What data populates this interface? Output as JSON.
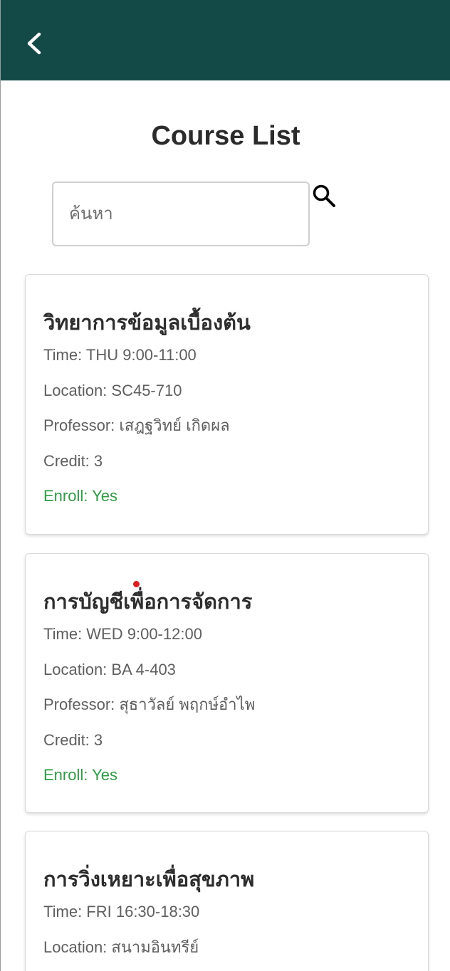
{
  "header": {
    "back_icon": "chevron-left-icon"
  },
  "page": {
    "title": "Course List"
  },
  "search": {
    "placeholder": "ค้นหา",
    "icon": "search-icon"
  },
  "labels": {
    "time": "Time: ",
    "location": "Location: ",
    "professor": "Professor: ",
    "credit": "Credit: ",
    "enroll": "Enroll: "
  },
  "courses": [
    {
      "name": "วิทยาการข้อมูลเบื้องต้น",
      "time": "Time: THU 9:00-11:00",
      "location": "Location: SC45-710",
      "professor": "Professor: เสฎฐวิทย์ เกิดผล",
      "credit": "Credit: 3",
      "enroll": "Enroll: Yes"
    },
    {
      "name": "การบัญชีเพื่อการจัดการ",
      "time": "Time: WED 9:00-12:00",
      "location": "Location: BA 4-403",
      "professor": "Professor: สุธาวัลย์ พฤกษ์อำไพ",
      "credit": "Credit: 3",
      "enroll": "Enroll: Yes"
    },
    {
      "name": "การวิ่งเหยาะเพื่อสุขภาพ",
      "time": "Time: FRI 16:30-18:30",
      "location": "Location: สนามอินทรีย์"
    }
  ],
  "colors": {
    "header_bg": "#134946",
    "enroll_text": "#2e9e43",
    "title_text": "#2b2b2b",
    "muted_text": "#5f5f5f"
  }
}
